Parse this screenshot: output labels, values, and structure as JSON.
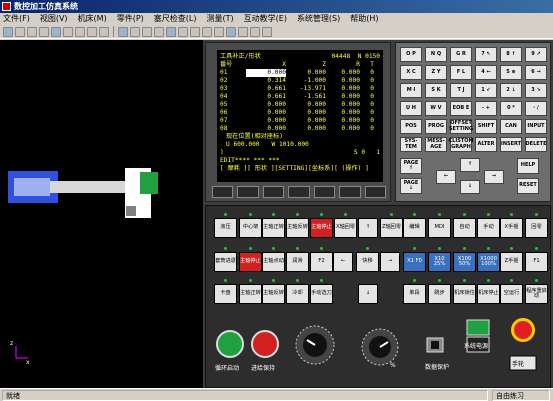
{
  "title": "数控加工仿真系统",
  "menu": [
    "文件(F)",
    "视图(V)",
    "机床(M)",
    "零件(P)",
    "塞尺检查(L)",
    "测量(T)",
    "互动教学(E)",
    "系统管理(S)",
    "帮助(H)"
  ],
  "screen": {
    "header": "工具补正/形状",
    "prog": "04448",
    "seq": "N  0150",
    "cols": [
      "番号",
      "X",
      "Z",
      "R",
      "T"
    ],
    "rows": [
      [
        "01",
        "0.000",
        "0.000",
        "0.000",
        "0"
      ],
      [
        "02",
        "0.314",
        "-1.000",
        "0.000",
        "0"
      ],
      [
        "03",
        "0.661",
        "-13.971",
        "0.000",
        "0"
      ],
      [
        "04",
        "0.661",
        "-1.561",
        "0.000",
        "0"
      ],
      [
        "05",
        "0.000",
        "0.000",
        "0.000",
        "0"
      ],
      [
        "06",
        "0.000",
        "0.000",
        "0.000",
        "0"
      ],
      [
        "07",
        "0.000",
        "0.000",
        "0.000",
        "0"
      ],
      [
        "08",
        "0.000",
        "0.000",
        "0.000",
        "0"
      ]
    ],
    "pos_label": "现在位置(相对座标)",
    "u": "U      600.000",
    "w": "W      1010.000",
    "prompt": ")",
    "s": "S    0",
    "t": "1",
    "mode": "EDIT**** *** ***",
    "softkeys": "[ 摩耗 ][ 形状 ][SETTING][坐标系][ (操作) ]"
  },
  "keypad": {
    "row1": [
      "O P",
      "N Q",
      "G R",
      "7 ↖",
      "8 ↑",
      "9 ↗"
    ],
    "row2": [
      "X C",
      "Z Y",
      "F L",
      "4 ←",
      "5 ⊕",
      "6 →"
    ],
    "row3": [
      "M I",
      "S K",
      "T J",
      "1 ↙",
      "2 ↓",
      "3 ↘"
    ],
    "row4": [
      "U H",
      "W V",
      "EOB E",
      "- +",
      "0 *",
      "· /"
    ],
    "row5": [
      "POS",
      "PROG",
      "OFFSET SETTING",
      "SHIFT",
      "CAN",
      "INPUT"
    ],
    "row6": [
      "SYS-TEM",
      "MESS-AGE",
      "CLISTOM GRAPH",
      "ALTER",
      "INSERT",
      "DELETE"
    ],
    "page_up": "PAGE ↑",
    "page_dn": "PAGE ↓",
    "help": "HELP",
    "reset": "RESET",
    "arrows": [
      "↑",
      "←",
      "↓",
      "→"
    ]
  },
  "control": {
    "row1": [
      "液压",
      "中心架",
      "主轴正转",
      "主轴反转",
      "主轴停止",
      "X轴回零",
      "Z轴回零",
      "编辑",
      "MDI",
      "自动",
      "手动",
      "X手摇",
      "回零"
    ],
    "row2": [
      "套筒进退",
      "主轴停止",
      "主轴点动",
      "润滑",
      "F2",
      "快移",
      "X1 F0",
      "X10 25%",
      "X100 50%",
      "X1000 100%",
      "Z手摇",
      "F1"
    ],
    "row3": [
      "卡盘",
      "主轴正转",
      "主轴反转",
      "冷却",
      "手动选刀",
      "单段",
      "跳步",
      "机床锁住",
      "机床停止",
      "空运行",
      "程序重启动"
    ],
    "cycle_start": "循环启动",
    "feed_hold": "进给保持",
    "data_protect": "数据保护",
    "sys_power": "系统电源",
    "handwheel": "手轮",
    "pct": "%"
  },
  "status": {
    "left": "就绪",
    "right": "自由练习"
  }
}
